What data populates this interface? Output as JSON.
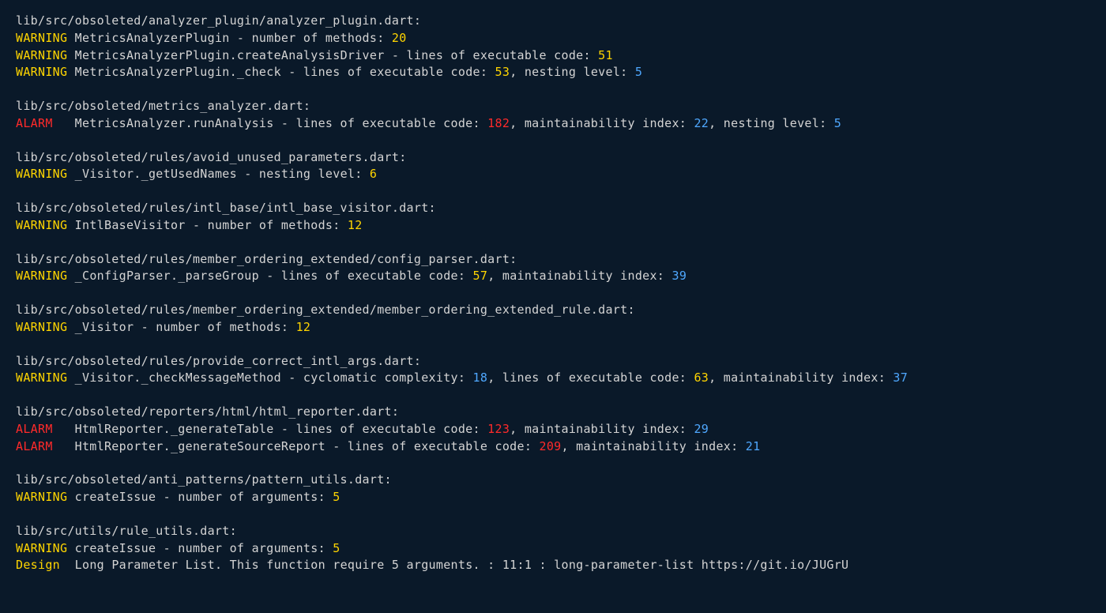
{
  "blocks": [
    {
      "path": "lib/src/obsoleted/analyzer_plugin/analyzer_plugin.dart:",
      "lines": [
        {
          "level": "WARNING",
          "levelClass": "level-warning",
          "segments": [
            {
              "t": " MetricsAnalyzerPlugin - number of methods: ",
              "c": "msg"
            },
            {
              "t": "20",
              "c": "num-warn"
            }
          ]
        },
        {
          "level": "WARNING",
          "levelClass": "level-warning",
          "segments": [
            {
              "t": " MetricsAnalyzerPlugin.createAnalysisDriver - lines of executable code: ",
              "c": "msg"
            },
            {
              "t": "51",
              "c": "num-warn"
            }
          ]
        },
        {
          "level": "WARNING",
          "levelClass": "level-warning",
          "segments": [
            {
              "t": " MetricsAnalyzerPlugin._check - lines of executable code: ",
              "c": "msg"
            },
            {
              "t": "53",
              "c": "num-warn"
            },
            {
              "t": ", nesting level: ",
              "c": "msg"
            },
            {
              "t": "5",
              "c": "num-info"
            }
          ]
        }
      ]
    },
    {
      "path": "lib/src/obsoleted/metrics_analyzer.dart:",
      "lines": [
        {
          "level": "ALARM",
          "levelClass": "level-alarm",
          "segments": [
            {
              "t": "   MetricsAnalyzer.runAnalysis - lines of executable code: ",
              "c": "msg"
            },
            {
              "t": "182",
              "c": "num-alarm"
            },
            {
              "t": ", maintainability index: ",
              "c": "msg"
            },
            {
              "t": "22",
              "c": "num-info"
            },
            {
              "t": ", nesting level: ",
              "c": "msg"
            },
            {
              "t": "5",
              "c": "num-info"
            }
          ]
        }
      ]
    },
    {
      "path": "lib/src/obsoleted/rules/avoid_unused_parameters.dart:",
      "lines": [
        {
          "level": "WARNING",
          "levelClass": "level-warning",
          "segments": [
            {
              "t": " _Visitor._getUsedNames - nesting level: ",
              "c": "msg"
            },
            {
              "t": "6",
              "c": "num-warn"
            }
          ]
        }
      ]
    },
    {
      "path": "lib/src/obsoleted/rules/intl_base/intl_base_visitor.dart:",
      "lines": [
        {
          "level": "WARNING",
          "levelClass": "level-warning",
          "segments": [
            {
              "t": " IntlBaseVisitor - number of methods: ",
              "c": "msg"
            },
            {
              "t": "12",
              "c": "num-warn"
            }
          ]
        }
      ]
    },
    {
      "path": "lib/src/obsoleted/rules/member_ordering_extended/config_parser.dart:",
      "lines": [
        {
          "level": "WARNING",
          "levelClass": "level-warning",
          "segments": [
            {
              "t": " _ConfigParser._parseGroup - lines of executable code: ",
              "c": "msg"
            },
            {
              "t": "57",
              "c": "num-warn"
            },
            {
              "t": ", maintainability index: ",
              "c": "msg"
            },
            {
              "t": "39",
              "c": "num-info"
            }
          ]
        }
      ]
    },
    {
      "path": "lib/src/obsoleted/rules/member_ordering_extended/member_ordering_extended_rule.dart:",
      "lines": [
        {
          "level": "WARNING",
          "levelClass": "level-warning",
          "segments": [
            {
              "t": " _Visitor - number of methods: ",
              "c": "msg"
            },
            {
              "t": "12",
              "c": "num-warn"
            }
          ]
        }
      ]
    },
    {
      "path": "lib/src/obsoleted/rules/provide_correct_intl_args.dart:",
      "lines": [
        {
          "level": "WARNING",
          "levelClass": "level-warning",
          "segments": [
            {
              "t": " _Visitor._checkMessageMethod - cyclomatic complexity: ",
              "c": "msg"
            },
            {
              "t": "18",
              "c": "num-info"
            },
            {
              "t": ", lines of executable code: ",
              "c": "msg"
            },
            {
              "t": "63",
              "c": "num-warn"
            },
            {
              "t": ", maintainability index: ",
              "c": "msg"
            },
            {
              "t": "37",
              "c": "num-info"
            }
          ]
        }
      ]
    },
    {
      "path": "lib/src/obsoleted/reporters/html/html_reporter.dart:",
      "lines": [
        {
          "level": "ALARM",
          "levelClass": "level-alarm",
          "segments": [
            {
              "t": "   HtmlReporter._generateTable - lines of executable code: ",
              "c": "msg"
            },
            {
              "t": "123",
              "c": "num-alarm"
            },
            {
              "t": ", maintainability index: ",
              "c": "msg"
            },
            {
              "t": "29",
              "c": "num-info"
            }
          ]
        },
        {
          "level": "ALARM",
          "levelClass": "level-alarm",
          "segments": [
            {
              "t": "   HtmlReporter._generateSourceReport - lines of executable code: ",
              "c": "msg"
            },
            {
              "t": "209",
              "c": "num-alarm"
            },
            {
              "t": ", maintainability index: ",
              "c": "msg"
            },
            {
              "t": "21",
              "c": "num-info"
            }
          ]
        }
      ]
    },
    {
      "path": "lib/src/obsoleted/anti_patterns/pattern_utils.dart:",
      "lines": [
        {
          "level": "WARNING",
          "levelClass": "level-warning",
          "segments": [
            {
              "t": " createIssue - number of arguments: ",
              "c": "msg"
            },
            {
              "t": "5",
              "c": "num-warn"
            }
          ]
        }
      ]
    },
    {
      "path": "lib/src/utils/rule_utils.dart:",
      "lines": [
        {
          "level": "WARNING",
          "levelClass": "level-warning",
          "segments": [
            {
              "t": " createIssue - number of arguments: ",
              "c": "msg"
            },
            {
              "t": "5",
              "c": "num-warn"
            }
          ]
        },
        {
          "level": "Design",
          "levelClass": "level-design",
          "segments": [
            {
              "t": "  Long Parameter List. This function require 5 arguments. : 11:1 : long-parameter-list https://git.io/JUGrU",
              "c": "msg"
            }
          ]
        }
      ]
    }
  ]
}
